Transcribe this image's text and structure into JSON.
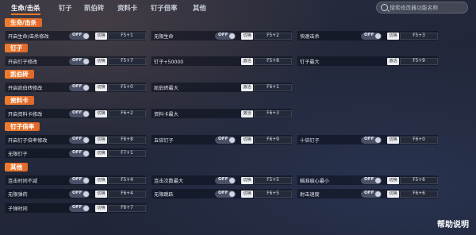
{
  "tabs": [
    "生命/击杀",
    "钉子",
    "凯伯砖",
    "资料卡",
    "钉子倍率",
    "其他"
  ],
  "search": {
    "placeholder": "搜索修改器功能名称"
  },
  "sections": [
    "生命/击杀",
    "钉子",
    "凯伯砖",
    "资料卡",
    "钉子倍率",
    "其他"
  ],
  "rows": [
    [
      "开启生命/击杀修改",
      "OFF",
      "切换",
      "F5+1"
    ],
    [
      "无限生命",
      "OFF",
      "切换",
      "F5+2"
    ],
    [
      "快速击杀",
      "OFF",
      "切换",
      "F5+3"
    ],
    [
      "开启钉子修改",
      "OFF",
      "切换",
      "F5+7"
    ],
    [
      "钉子+50000",
      "OFF",
      "激活",
      "F5+8"
    ],
    [
      "钉子最大",
      "OFF",
      "激活",
      "F5+9"
    ],
    [
      "开启凯伯砖修改",
      "OFF",
      "切换",
      "F5+0"
    ],
    [
      "凯伯砖最大",
      "OFF",
      "激活",
      "F6+1"
    ],
    [
      "开启资料卡修改",
      "OFF",
      "切换",
      "F6+2"
    ],
    [
      "资料卡最大",
      "OFF",
      "激活",
      "F6+3"
    ],
    [
      "开启钉子倍率修改",
      "OFF",
      "切换",
      "F6+8"
    ],
    [
      "五倍钉子",
      "OFF",
      "切换",
      "F6+9"
    ],
    [
      "十倍钉子",
      "OFF",
      "切换",
      "F6+0"
    ],
    [
      "无限钉子",
      "OFF",
      "切换",
      "F7+1"
    ],
    [
      "连击时间不减",
      "OFF",
      "切换",
      "F5+4"
    ],
    [
      "连击次数最大",
      "OFF",
      "切换",
      "F5+5"
    ],
    [
      "瞄准痕心最小",
      "OFF",
      "切换",
      "F5+6"
    ],
    [
      "无限弹药",
      "OFF",
      "切换",
      "F6+4"
    ],
    [
      "无限跳跃",
      "OFF",
      "切换",
      "F6+5"
    ],
    [
      "射击速度",
      "OFF",
      "切换",
      "F6+6"
    ],
    [
      "子弹时间",
      "OFF",
      "切换",
      "F6+7"
    ]
  ],
  "help_label": "帮助说明"
}
